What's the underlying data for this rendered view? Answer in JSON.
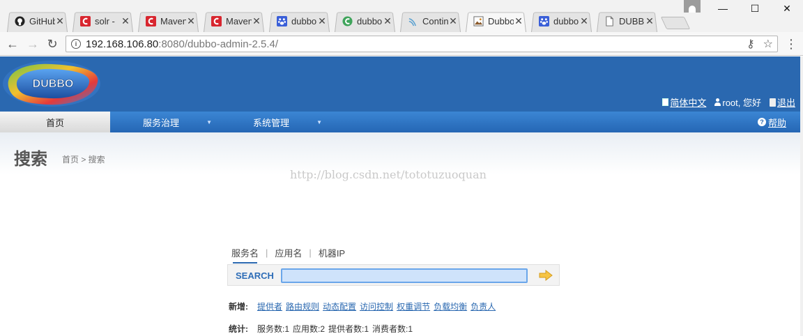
{
  "browser": {
    "tabs": [
      {
        "label": "GitHub",
        "icon": "github-icon",
        "active": false
      },
      {
        "label": "solr -",
        "icon": "csdn-icon",
        "active": false
      },
      {
        "label": "Maven",
        "icon": "csdn-icon",
        "active": false
      },
      {
        "label": "Maven",
        "icon": "csdn-icon",
        "active": false
      },
      {
        "label": "dubbo",
        "icon": "baidu-icon",
        "active": false
      },
      {
        "label": "dubbo",
        "icon": "green-c-icon",
        "active": false
      },
      {
        "label": "Contin",
        "icon": "wave-icon",
        "active": false
      },
      {
        "label": "Dubbo",
        "icon": "image-icon",
        "active": true
      },
      {
        "label": "dubbo",
        "icon": "baidu-icon",
        "active": false
      },
      {
        "label": "DUBB",
        "icon": "document-icon",
        "active": false
      }
    ],
    "url_host": "192.168.106.80",
    "url_rest": ":8080/dubbo-admin-2.5.4/"
  },
  "header": {
    "logo_text": "DUBBO",
    "lang_link": "简体中文",
    "user_greeting": "root, 您好",
    "logout": "退出"
  },
  "nav": {
    "items": [
      "首页",
      "服务治理",
      "系统管理"
    ],
    "help": "帮助"
  },
  "page": {
    "title": "搜索",
    "breadcrumb": "首页 > 搜索",
    "watermark": "http://blog.csdn.net/tototuzuoquan"
  },
  "search": {
    "tabs": [
      "服务名",
      "应用名",
      "机器IP"
    ],
    "label": "SEARCH",
    "value": ""
  },
  "new_row": {
    "label": "新增:",
    "links": [
      "提供者",
      "路由规则",
      "动态配置",
      "访问控制",
      "权重调节",
      "负载均衡",
      "负责人"
    ]
  },
  "stats_row": {
    "label": "统计:",
    "items": [
      "服务数:1",
      "应用数:2",
      "提供者数:1",
      "消费者数:1"
    ]
  },
  "colors": {
    "header_blue": "#2a68b0",
    "nav_blue": "#3b86d4",
    "link_blue": "#2a68b0"
  }
}
